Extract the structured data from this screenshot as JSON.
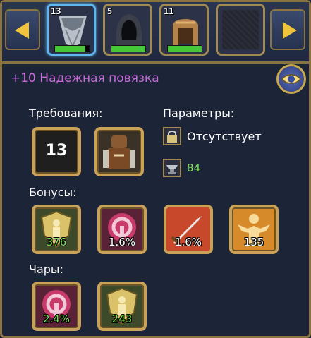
{
  "carousel": {
    "slots": [
      {
        "level": "13",
        "health_fraction": 0.9,
        "selected": true,
        "icon": "cloth-bandage-icon"
      },
      {
        "level": "5",
        "health_fraction": 1.0,
        "selected": false,
        "icon": "hood-icon"
      },
      {
        "level": "11",
        "health_fraction": 1.0,
        "selected": false,
        "icon": "helmet-icon"
      },
      {
        "level": "",
        "health_fraction": 0,
        "selected": false,
        "icon": "empty-slot-icon"
      }
    ]
  },
  "item": {
    "title": "+10 Надежная повязка",
    "title_color": "#c86ad8"
  },
  "requirements": {
    "label": "Требования:",
    "level": "13",
    "class_icon": "warrior-class-icon"
  },
  "parameters": {
    "label": "Параметры:",
    "lock_text": "Отсутствует",
    "anvil_value": "84"
  },
  "bonuses": {
    "label": "Бонусы:",
    "items": [
      {
        "icon": "shield-defense-icon",
        "value": "376",
        "green": true
      },
      {
        "icon": "magic-resist-icon",
        "value": "1.6%",
        "green": false
      },
      {
        "icon": "sword-damage-icon",
        "value": "1.6%",
        "green": false
      },
      {
        "icon": "strength-icon",
        "value": "135",
        "green": false
      }
    ]
  },
  "enchant": {
    "label": "Чары:",
    "items": [
      {
        "icon": "magic-resist-icon",
        "value": "2.4%",
        "green": true
      },
      {
        "icon": "shield-defense-icon",
        "value": "243",
        "green": true
      }
    ]
  }
}
